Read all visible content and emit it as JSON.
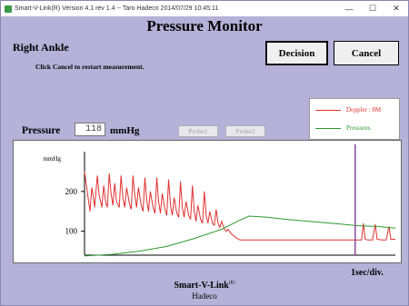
{
  "window": {
    "title": "Smart-V-Link(R)  Version 4.1 rev 1.4  -- Taro Hadeco  2014/07/29    10:45:11",
    "minimize_glyph": "—",
    "maximize_glyph": "☐",
    "close_glyph": "✕"
  },
  "header": {
    "title": "Pressure Monitor"
  },
  "measurement": {
    "site": "Right Ankle",
    "instruction": "Click Cancel to restart measurement."
  },
  "buttons": {
    "decision": "Decision",
    "cancel": "Cancel"
  },
  "legend": {
    "items": [
      {
        "label": "Doppler : 8M",
        "color": "#e03030"
      },
      {
        "label": "Pressures",
        "color": "#2e9a2e"
      }
    ]
  },
  "pressure": {
    "label": "Pressure",
    "value": "118",
    "unit": "mmHg"
  },
  "probes": {
    "probe1": "Probe1",
    "probe2": "Probe2"
  },
  "chart_data": {
    "type": "line",
    "ylabel": "mmHg",
    "yticks": [
      100,
      200
    ],
    "ylim": [
      40,
      300
    ],
    "xlim": [
      0,
      34
    ],
    "x_unit_label": "1sec/div.",
    "cursor_x": 29.6,
    "series": [
      {
        "name": "Doppler : 8M",
        "color": "#e03030",
        "values": [
          [
            0.0,
            250
          ],
          [
            0.3,
            200
          ],
          [
            0.6,
            150
          ],
          [
            0.8,
            210
          ],
          [
            1.0,
            180
          ],
          [
            1.1,
            160
          ],
          [
            1.4,
            240
          ],
          [
            1.6,
            190
          ],
          [
            1.9,
            160
          ],
          [
            2.1,
            215
          ],
          [
            2.3,
            175
          ],
          [
            2.5,
            160
          ],
          [
            2.7,
            245
          ],
          [
            2.9,
            195
          ],
          [
            3.1,
            165
          ],
          [
            3.3,
            220
          ],
          [
            3.5,
            175
          ],
          [
            3.8,
            160
          ],
          [
            4.0,
            240
          ],
          [
            4.2,
            185
          ],
          [
            4.4,
            160
          ],
          [
            4.6,
            210
          ],
          [
            4.9,
            170
          ],
          [
            5.1,
            155
          ],
          [
            5.3,
            240
          ],
          [
            5.5,
            190
          ],
          [
            5.7,
            160
          ],
          [
            5.9,
            210
          ],
          [
            6.2,
            165
          ],
          [
            6.4,
            150
          ],
          [
            6.6,
            235
          ],
          [
            6.8,
            180
          ],
          [
            7.0,
            150
          ],
          [
            7.2,
            200
          ],
          [
            7.5,
            160
          ],
          [
            7.7,
            145
          ],
          [
            7.9,
            235
          ],
          [
            8.1,
            175
          ],
          [
            8.3,
            145
          ],
          [
            8.5,
            195
          ],
          [
            8.8,
            155
          ],
          [
            9.0,
            140
          ],
          [
            9.2,
            230
          ],
          [
            9.4,
            165
          ],
          [
            9.6,
            140
          ],
          [
            9.8,
            185
          ],
          [
            10.1,
            145
          ],
          [
            10.3,
            135
          ],
          [
            10.5,
            225
          ],
          [
            10.7,
            160
          ],
          [
            10.9,
            135
          ],
          [
            11.1,
            175
          ],
          [
            11.4,
            140
          ],
          [
            11.6,
            130
          ],
          [
            11.8,
            215
          ],
          [
            12.0,
            150
          ],
          [
            12.2,
            125
          ],
          [
            12.4,
            165
          ],
          [
            12.7,
            130
          ],
          [
            12.9,
            120
          ],
          [
            13.1,
            200
          ],
          [
            13.3,
            140
          ],
          [
            13.5,
            120
          ],
          [
            13.7,
            150
          ],
          [
            14.0,
            120
          ],
          [
            14.2,
            115
          ],
          [
            14.4,
            155
          ],
          [
            14.6,
            120
          ],
          [
            14.8,
            110
          ],
          [
            15.0,
            125
          ],
          [
            15.3,
            105
          ],
          [
            15.5,
            100
          ],
          [
            15.7,
            105
          ],
          [
            16.0,
            95
          ],
          [
            16.5,
            85
          ],
          [
            17.0,
            78
          ],
          [
            18.0,
            78
          ],
          [
            19.0,
            78
          ],
          [
            20.0,
            78
          ],
          [
            21.0,
            78
          ],
          [
            22.0,
            78
          ],
          [
            23.0,
            78
          ],
          [
            24.0,
            78
          ],
          [
            25.0,
            78
          ],
          [
            26.0,
            78
          ],
          [
            27.0,
            78
          ],
          [
            28.0,
            78
          ],
          [
            29.0,
            78
          ],
          [
            30.0,
            78
          ],
          [
            30.3,
            78
          ],
          [
            30.5,
            120
          ],
          [
            30.7,
            80
          ],
          [
            31.0,
            78
          ],
          [
            31.5,
            78
          ],
          [
            31.8,
            118
          ],
          [
            32.0,
            80
          ],
          [
            32.5,
            78
          ],
          [
            33.0,
            78
          ],
          [
            33.3,
            112
          ],
          [
            33.5,
            80
          ],
          [
            34.0,
            80
          ]
        ]
      },
      {
        "name": "Pressures",
        "color": "#2e9a2e",
        "values": [
          [
            0,
            38
          ],
          [
            3,
            42
          ],
          [
            6,
            50
          ],
          [
            9,
            62
          ],
          [
            12,
            82
          ],
          [
            15,
            105
          ],
          [
            17,
            128
          ],
          [
            18,
            138
          ],
          [
            20,
            135
          ],
          [
            22,
            130
          ],
          [
            24,
            126
          ],
          [
            26,
            122
          ],
          [
            28,
            118
          ],
          [
            30,
            114
          ],
          [
            32,
            112
          ],
          [
            34,
            108
          ]
        ]
      }
    ]
  }
}
